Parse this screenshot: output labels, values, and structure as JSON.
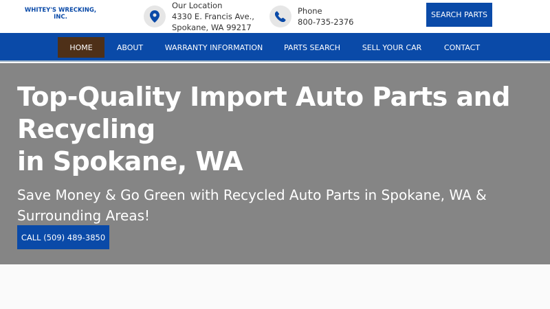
{
  "brand": {
    "name_line1": "WHITEY'S WRECKING,",
    "name_line2": "INC.",
    "color": "#0a4aa8"
  },
  "location": {
    "label": "Our Location",
    "address1": "4330 E. Francis Ave.,",
    "address2": "Spokane, WA 99217",
    "icon": "map-pin-icon"
  },
  "phone": {
    "label": "Phone",
    "number": "800-735-2376",
    "icon": "phone-icon"
  },
  "search_button": "SEARCH PARTS",
  "nav": {
    "items": [
      {
        "label": "HOME",
        "active": true
      },
      {
        "label": "ABOUT",
        "active": false
      },
      {
        "label": "WARRANTY INFORMATION",
        "active": false
      },
      {
        "label": "PARTS SEARCH",
        "active": false
      },
      {
        "label": "SELL YOUR CAR",
        "active": false
      },
      {
        "label": "CONTACT",
        "active": false
      }
    ]
  },
  "hero": {
    "title_line1": "Top-Quality Import Auto Parts and",
    "title_line2": "Recycling",
    "title_line3": "in Spokane, WA",
    "subtitle": "Save Money & Go Green with Recycled Auto Parts in Spokane, WA & Surrounding Areas!",
    "call_button": "CALL (509) 489-3850"
  },
  "colors": {
    "primary": "#0a4aa8",
    "active_nav": "#4e3018",
    "hero_bg": "#858585"
  }
}
